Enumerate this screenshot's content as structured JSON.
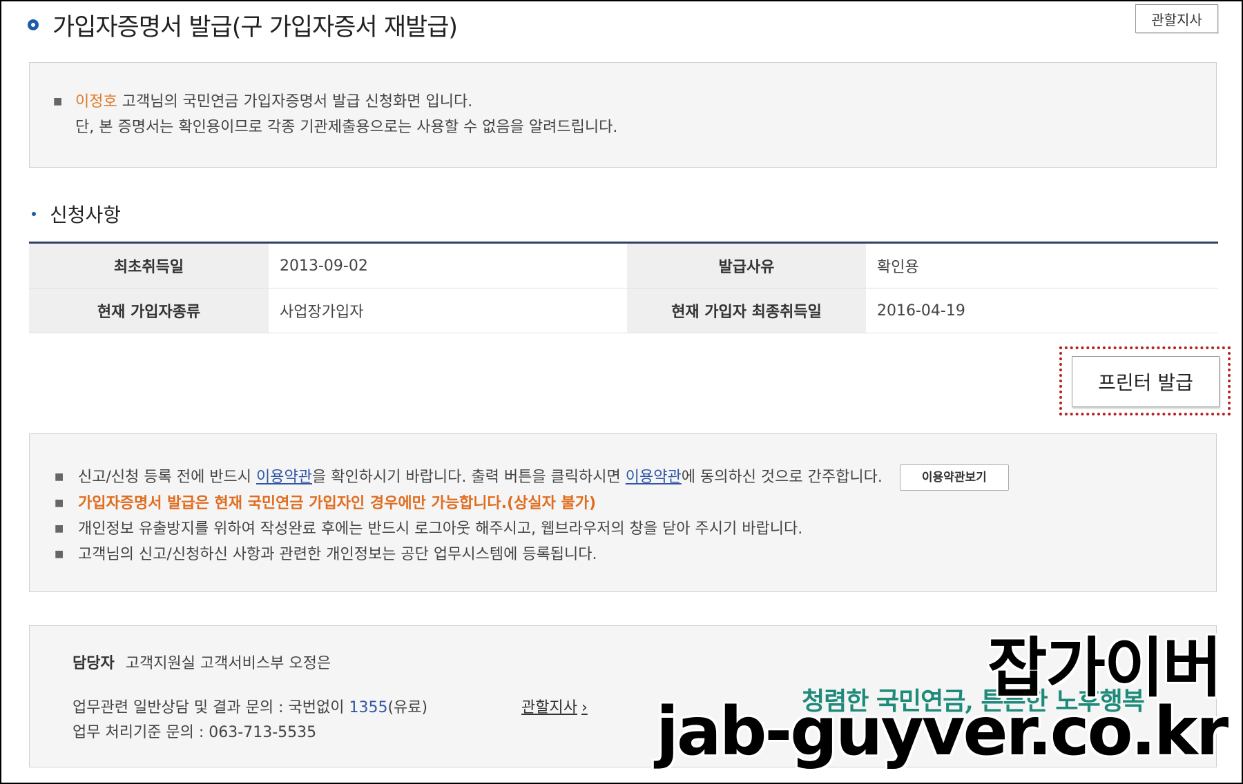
{
  "header": {
    "title": "가입자증명서 발급(구 가입자증서 재발급)",
    "branch_button": "관할지사"
  },
  "notice": {
    "name": "이정호",
    "line1_rest": " 고객님의 국민연금 가입자증명서 발급 신청화면 입니다.",
    "line2": "단, 본 증명서는 확인용이므로 각종 기관제출용으로는 사용할 수 없음을 알려드립니다."
  },
  "section": {
    "title": "신청사항"
  },
  "table": {
    "rows": [
      [
        {
          "label": "최초취득일",
          "value": "2013-09-02"
        },
        {
          "label": "발급사유",
          "value": "확인용"
        }
      ],
      [
        {
          "label": "현재 가입자종류",
          "value": "사업장가입자"
        },
        {
          "label": "현재 가입자 최종취득일",
          "value": "2016-04-19"
        }
      ]
    ]
  },
  "print_button": "프린터 발급",
  "guide": {
    "line1": {
      "a": "신고/신청 등록 전에 반드시 ",
      "link1": "이용약관",
      "b": "을 확인하시기 바랍니다. 출력 버튼을 클릭하시면 ",
      "link2": "이용약관",
      "c": "에 동의하신 것으로 간주합니다.",
      "button": "이용약관보기"
    },
    "line2": "가입자증명서 발급은 현재 국민연금 가입자인 경우에만 가능합니다.(상실자 불가)",
    "line3": "개인정보 유출방지를 위하여 작성완료 후에는 반드시 로그아웃 해주시고, 웹브라우저의 창을 닫아 주시기 바랍니다.",
    "line4": "고객님의 신고/신청하신 사항과 관련한 개인정보는 공단 업무시스템에 등록됩니다."
  },
  "contact": {
    "manager_label": "담당자",
    "manager_value": "고객지원실 고객서비스부 오정은",
    "line1_a": "업무관련 일반상담 및 결과 문의 : 국번없이 ",
    "line1_num": "1355",
    "line1_b": "(유료)",
    "line2": "업무 처리기준 문의 : 063-713-5535",
    "branch_link": "관할지사",
    "slogan": "청렴한 국민연금, 튼튼한 노후행복"
  },
  "watermark": {
    "line1": "잡가이버",
    "line2": "jab-guyver.co.kr"
  },
  "colors": {
    "accent": "#1a5ca8",
    "highlight_name": "#e07a2b",
    "warning": "#e06d1f",
    "link": "#2f56a6",
    "print_outline": "#b52020",
    "slogan": "#1e8a7a"
  }
}
